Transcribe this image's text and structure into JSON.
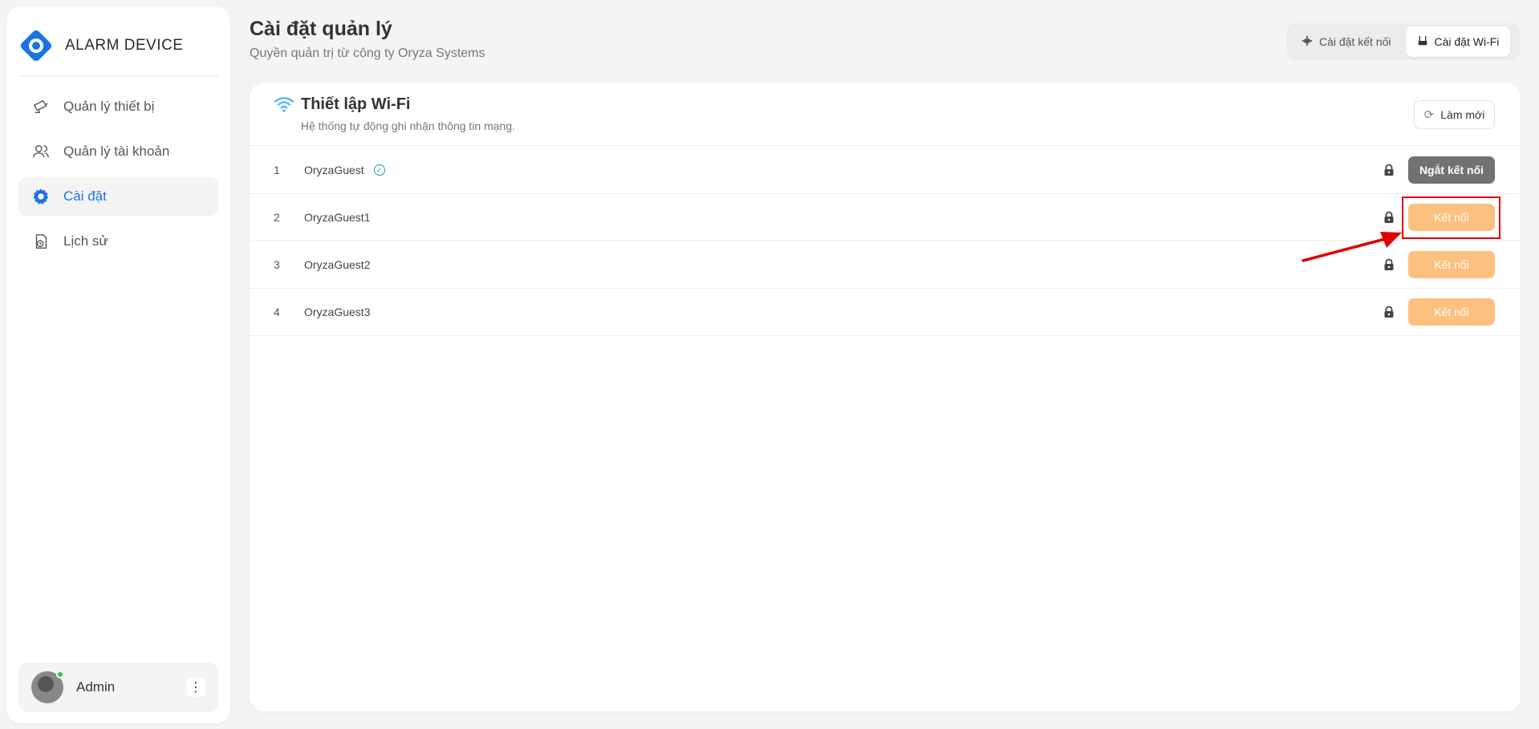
{
  "brand": {
    "name": "ALARM DEVICE",
    "color": "#1b74e4"
  },
  "sidebar": {
    "items": [
      {
        "label": "Quản lý thiết bị",
        "icon": "cctv-camera-icon",
        "active": false
      },
      {
        "label": "Quản lý tài khoản",
        "icon": "users-icon",
        "active": false
      },
      {
        "label": "Cài đặt",
        "icon": "gear-icon",
        "active": true
      },
      {
        "label": "Lịch sử",
        "icon": "history-icon",
        "active": false
      }
    ],
    "user": {
      "name": "Admin",
      "status": "online"
    }
  },
  "header": {
    "title": "Cài đặt quản lý",
    "subtitle": "Quyền quản trị từ công ty Oryza Systems",
    "tabs": [
      {
        "label": "Cài đặt kết nối",
        "icon": "connection-icon",
        "active": false
      },
      {
        "label": "Cài đặt Wi-Fi",
        "icon": "router-icon",
        "active": true
      }
    ]
  },
  "wifi_panel": {
    "title": "Thiết lập Wi-Fi",
    "subtitle": "Hệ thống tự động ghi nhận thông tin mạng.",
    "refresh_label": "Làm mới",
    "networks": [
      {
        "index": "1",
        "ssid": "OryzaGuest",
        "connected": true,
        "secured": true,
        "action": "Ngắt kết nối"
      },
      {
        "index": "2",
        "ssid": "OryzaGuest1",
        "connected": false,
        "secured": true,
        "action": "Kết nối"
      },
      {
        "index": "3",
        "ssid": "OryzaGuest2",
        "connected": false,
        "secured": true,
        "action": "Kết nối"
      },
      {
        "index": "4",
        "ssid": "OryzaGuest3",
        "connected": false,
        "secured": true,
        "action": "Kết nối"
      }
    ]
  },
  "colors": {
    "accent": "#1b74e4",
    "connect_button": "#fdc07e",
    "disconnect_button": "#727272",
    "annotation": "#e00000",
    "wifi_icon": "#5bb8f0"
  }
}
